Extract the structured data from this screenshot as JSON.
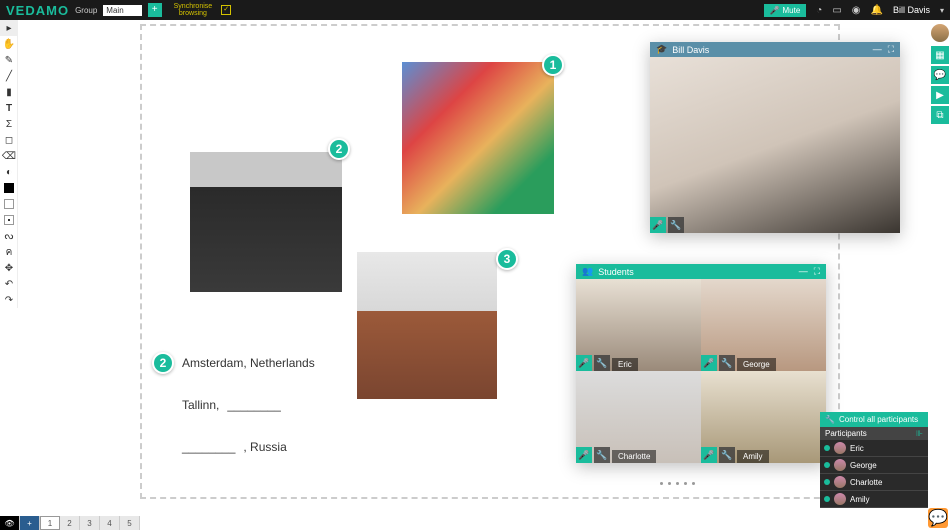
{
  "topbar": {
    "logo": "VEDAMO",
    "group_label": "Group",
    "group_value": "Main",
    "sync_label": "Synchronise\nbrowsing",
    "mute_label": "Mute",
    "user_name": "Bill Davis"
  },
  "canvas": {
    "badges": {
      "b1": "1",
      "b2a": "2",
      "b2b": "2",
      "b3": "3"
    },
    "answers": {
      "a1": "Amsterdam, Netherlands",
      "a2_pre": "Tallinn, ",
      "a2_blank": "________",
      "a3_blank": "________",
      "a3_post": ", Russia"
    }
  },
  "video": {
    "teacher_name": "Bill Davis",
    "students_label": "Students",
    "students": [
      "Eric",
      "George",
      "Charlotte",
      "Amily"
    ]
  },
  "participants": {
    "header": "Control all participants",
    "sub": "Participants",
    "list": [
      "Eric",
      "George",
      "Charlotte",
      "Amily"
    ]
  },
  "pager": [
    "1",
    "2",
    "3",
    "4",
    "5"
  ],
  "colors": {
    "teal": "#1abc9c"
  }
}
